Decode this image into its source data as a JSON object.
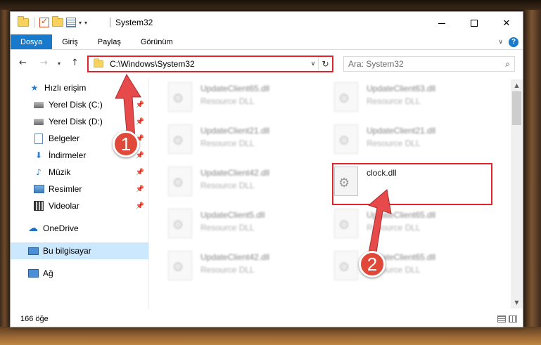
{
  "window": {
    "title": "System32",
    "controls": {
      "minimize": "Simge durumuna küçült",
      "maximize": "Ekranı kapla",
      "close": "✕"
    }
  },
  "ribbon": {
    "tabs": [
      {
        "label": "Dosya",
        "active": true
      },
      {
        "label": "Giriş",
        "active": false
      },
      {
        "label": "Paylaş",
        "active": false
      },
      {
        "label": "Görünüm",
        "active": false
      }
    ],
    "help": "?"
  },
  "address": {
    "path": "C:\\Windows\\System32",
    "search_placeholder": "Ara: System32"
  },
  "sidebar": {
    "items": [
      {
        "label": "Hızlı erişim",
        "icon": "star-icon",
        "pinned": false
      },
      {
        "label": "Yerel Disk (C:)",
        "icon": "drive-icon",
        "pinned": true
      },
      {
        "label": "Yerel Disk (D:)",
        "icon": "drive-icon",
        "pinned": true
      },
      {
        "label": "Belgeler",
        "icon": "documents-icon",
        "pinned": true
      },
      {
        "label": "İndirmeler",
        "icon": "download-icon",
        "pinned": true
      },
      {
        "label": "Müzik",
        "icon": "music-icon",
        "pinned": true
      },
      {
        "label": "Resimler",
        "icon": "pictures-icon",
        "pinned": true
      },
      {
        "label": "Videolar",
        "icon": "videos-icon",
        "pinned": true
      },
      {
        "label": "OneDrive",
        "icon": "cloud-icon",
        "pinned": false
      },
      {
        "label": "Bu bilgisayar",
        "icon": "computer-icon",
        "pinned": false,
        "selected": true
      },
      {
        "label": "Ağ",
        "icon": "network-icon",
        "pinned": false
      }
    ]
  },
  "files": [
    {
      "name": "UpdateClient65.dll",
      "type": "Resource DLL",
      "blurred": true
    },
    {
      "name": "UpdateClient63.dll",
      "type": "Resource DLL",
      "blurred": true
    },
    {
      "name": "UpdateClient21.dll",
      "type": "Resource DLL",
      "blurred": true
    },
    {
      "name": "UpdateClient21.dll",
      "type": "Resource DLL",
      "blurred": true
    },
    {
      "name": "UpdateClient42.dll",
      "type": "Resource DLL",
      "blurred": true
    },
    {
      "name": "clock.dll",
      "type": "",
      "blurred": false,
      "highlighted": true
    },
    {
      "name": "UpdateClient5.dll",
      "type": "Resource DLL",
      "blurred": true
    },
    {
      "name": "UpdateClient65.dll",
      "type": "Resource DLL",
      "blurred": true
    },
    {
      "name": "UpdateClient42.dll",
      "type": "Resource DLL",
      "blurred": true
    },
    {
      "name": "UpdateClient65.dll",
      "type": "Resource DLL",
      "blurred": true
    }
  ],
  "status": {
    "count": "166 öğe"
  },
  "annotations": [
    {
      "number": "1",
      "color": "#e0483a"
    },
    {
      "number": "2",
      "color": "#e0483a"
    }
  ]
}
